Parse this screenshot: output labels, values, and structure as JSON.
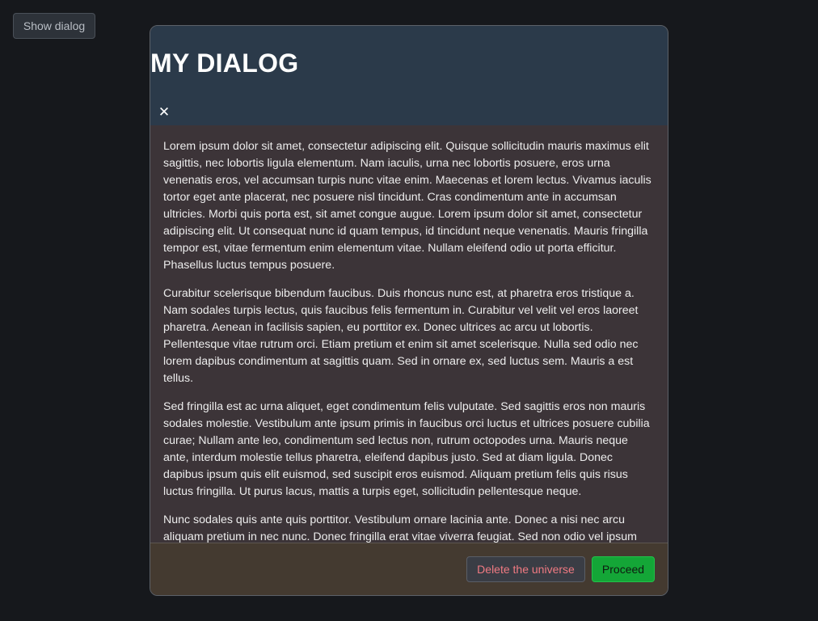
{
  "page": {
    "show_dialog_label": "Show dialog"
  },
  "dialog": {
    "title": "MY DIALOG",
    "close_label": "✕",
    "paragraphs": [
      "Lorem ipsum dolor sit amet, consectetur adipiscing elit. Quisque sollicitudin mauris maximus elit sagittis, nec lobortis ligula elementum. Nam iaculis, urna nec lobortis posuere, eros urna venenatis eros, vel accumsan turpis nunc vitae enim. Maecenas et lorem lectus. Vivamus iaculis tortor eget ante placerat, nec posuere nisl tincidunt. Cras condimentum ante in accumsan ultricies. Morbi quis porta est, sit amet congue augue. Lorem ipsum dolor sit amet, consectetur adipiscing elit. Ut consequat nunc id quam tempus, id tincidunt neque venenatis. Mauris fringilla tempor est, vitae fermentum enim elementum vitae. Nullam eleifend odio ut porta efficitur. Phasellus luctus tempus posuere.",
      "Curabitur scelerisque bibendum faucibus. Duis rhoncus nunc est, at pharetra eros tristique a. Nam sodales turpis lectus, quis faucibus felis fermentum in. Curabitur vel velit vel eros laoreet pharetra. Aenean in facilisis sapien, eu porttitor ex. Donec ultrices ac arcu ut lobortis. Pellentesque vitae rutrum orci. Etiam pretium et enim sit amet scelerisque. Nulla sed odio nec lorem dapibus condimentum at sagittis quam. Sed in ornare ex, sed luctus sem. Mauris a est tellus.",
      "Sed fringilla est ac urna aliquet, eget condimentum felis vulputate. Sed sagittis eros non mauris sodales molestie. Vestibulum ante ipsum primis in faucibus orci luctus et ultrices posuere cubilia curae; Nullam ante leo, condimentum sed lectus non, rutrum octopodes urna. Mauris neque ante, interdum molestie tellus pharetra, eleifend dapibus justo. Sed at diam ligula. Donec dapibus ipsum quis elit euismod, sed suscipit eros euismod. Aliquam pretium felis quis risus luctus fringilla. Ut purus lacus, mattis a turpis eget, sollicitudin pellentesque neque.",
      "Nunc sodales quis ante quis porttitor. Vestibulum ornare lacinia ante. Donec a nisi nec arcu aliquam pretium in nec nunc. Donec fringilla erat vitae viverra feugiat. Sed non odio vel ipsum"
    ],
    "buttons": {
      "delete_label": "Delete the universe",
      "proceed_label": "Proceed"
    }
  },
  "colors": {
    "page_background": "#16181c",
    "header_background": "#2b3a4a",
    "body_background": "#3c3438",
    "footer_background": "#443a30",
    "danger_text": "#f07a82",
    "proceed_green": "#14a637"
  }
}
